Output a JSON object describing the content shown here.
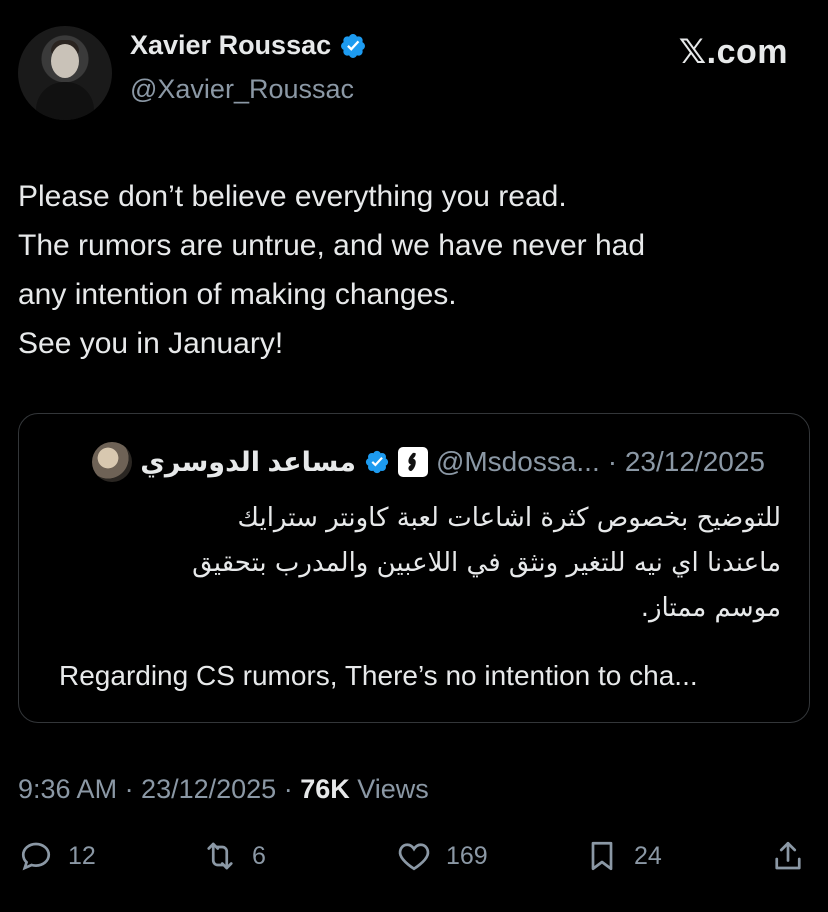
{
  "author": {
    "name": "Xavier Roussac",
    "handle": "@Xavier_Roussac",
    "verified": true
  },
  "brand": "𝕏.com",
  "tweet": {
    "lines": [
      "Please don’t believe everything you read.",
      "The rumors are untrue, and we have never had",
      "any intention of making changes.",
      "See you in January!"
    ]
  },
  "quote": {
    "name": "مساعد الدوسري",
    "handle": "@Msdossa...",
    "date": "· 23/12/2025",
    "verified": true,
    "arabic_lines": [
      "للتوضيح بخصوص كثرة اشاعات لعبة كاونتر سترايك",
      "ماعندنا اي نيه للتغير ونثق في اللاعبين والمدرب بتحقيق",
      "موسم ممتاز."
    ],
    "english": "Regarding CS rumors, There’s no intention to cha..."
  },
  "meta": {
    "time_date": "9:36 AM · 23/12/2025 · ",
    "views_count": "76K",
    "views_label": " Views"
  },
  "actions": {
    "replies": "12",
    "reposts": "6",
    "likes": "169",
    "bookmarks": "24"
  },
  "icons": {
    "reply": "reply-icon",
    "repost": "repost-icon",
    "like": "like-icon",
    "bookmark": "bookmark-icon",
    "share": "share-icon"
  },
  "colors": {
    "background": "#000000",
    "text": "#e7e9ea",
    "muted": "#8b98a5",
    "verified": "#1d9bf0",
    "border": "#333639"
  }
}
